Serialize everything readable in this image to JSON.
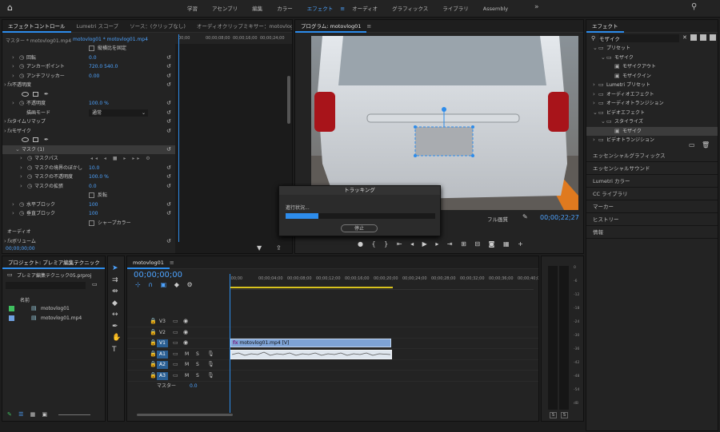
{
  "workspaces": {
    "items": [
      "学習",
      "アセンブリ",
      "編集",
      "カラー",
      "エフェクト",
      "オーディオ",
      "グラフィックス",
      "ライブラリ",
      "Assembly"
    ],
    "active": 4,
    "more": "»"
  },
  "effect_controls": {
    "tabs": [
      "エフェクトコントロール",
      "Lumetri スコープ",
      "ソース：(クリップなし)",
      "オーディオクリップミキサー：motovlog"
    ],
    "source_label": "マスター * motovlog01.mp4",
    "clip_label": "motovlog01 * motovlog01.mp4",
    "ruler": [
      "00;00",
      "00;00;08;00",
      "00;00;16;00",
      "00;00;24;00"
    ],
    "rows": [
      {
        "text": "縦横比を固定",
        "kind": "checkbox",
        "indent": 108,
        "value": ""
      },
      {
        "text": "回転",
        "kind": "prop",
        "indent": 30,
        "value": "0.0"
      },
      {
        "text": "アンカーポイント",
        "kind": "prop",
        "indent": 30,
        "value": "720.0    540.0"
      },
      {
        "text": "アンチフリッカー",
        "kind": "prop",
        "indent": 30,
        "value": "0.00"
      },
      {
        "text": "不透明度",
        "kind": "fx",
        "indent": 12,
        "value": ""
      },
      {
        "text": "",
        "kind": "shapes",
        "indent": 24,
        "value": ""
      },
      {
        "text": "不透明度",
        "kind": "prop",
        "indent": 30,
        "value": "100.0 %"
      },
      {
        "text": "描画モード",
        "kind": "select",
        "indent": 30,
        "value": "通常"
      },
      {
        "text": "タイムリマップ",
        "kind": "fx",
        "indent": 12,
        "value": ""
      },
      {
        "text": "モザイク",
        "kind": "fx",
        "indent": 12,
        "value": ""
      },
      {
        "text": "",
        "kind": "shapes",
        "indent": 24,
        "value": ""
      },
      {
        "text": "マスク (1)",
        "kind": "mask",
        "indent": 24,
        "value": ""
      },
      {
        "text": "マスクパス",
        "kind": "path",
        "indent": 40,
        "value": ""
      },
      {
        "text": "マスクの境界のぼかし",
        "kind": "prop",
        "indent": 40,
        "value": "10.0"
      },
      {
        "text": "マスクの不透明度",
        "kind": "prop",
        "indent": 40,
        "value": "100.0 %"
      },
      {
        "text": "マスクの拡張",
        "kind": "prop",
        "indent": 40,
        "value": "0.0"
      },
      {
        "text": "反転",
        "kind": "checkbox",
        "indent": 108,
        "value": ""
      },
      {
        "text": "水平ブロック",
        "kind": "prop",
        "indent": 30,
        "value": "100"
      },
      {
        "text": "垂直ブロック",
        "kind": "prop",
        "indent": 30,
        "value": "100"
      },
      {
        "text": "シャープカラー",
        "kind": "checkbox",
        "indent": 108,
        "value": ""
      },
      {
        "text": "オーディオ",
        "kind": "section",
        "indent": 6,
        "value": ""
      },
      {
        "text": "ボリューム",
        "kind": "fx",
        "indent": 12,
        "value": ""
      }
    ],
    "timecode": "00;00;00;00"
  },
  "program": {
    "tab": "プログラム: motovlog01",
    "timecode": "00;00;22;27",
    "quality": "フル画質"
  },
  "tracking": {
    "title": "トラッキング",
    "status": "進行状況...",
    "progress": 0.22,
    "stop": "停止"
  },
  "effects": {
    "tab": "エフェクト",
    "search": "モザイク",
    "tree": [
      {
        "label": "プリセット",
        "level": 0,
        "folder": true,
        "open": true
      },
      {
        "label": "モザイク",
        "level": 1,
        "folder": true,
        "open": true
      },
      {
        "label": "モザイクアウト",
        "level": 2,
        "folder": false
      },
      {
        "label": "モザイクイン",
        "level": 2,
        "folder": false
      },
      {
        "label": "Lumetri プリセット",
        "level": 0,
        "folder": true,
        "open": false
      },
      {
        "label": "オーディオエフェクト",
        "level": 0,
        "folder": true,
        "open": false
      },
      {
        "label": "オーディオトランジション",
        "level": 0,
        "folder": true,
        "open": false
      },
      {
        "label": "ビデオエフェクト",
        "level": 0,
        "folder": true,
        "open": true
      },
      {
        "label": "スタイライズ",
        "level": 1,
        "folder": true,
        "open": true
      },
      {
        "label": "モザイク",
        "level": 2,
        "folder": false,
        "selected": true
      },
      {
        "label": "ビデオトランジション",
        "level": 0,
        "folder": true,
        "open": false
      }
    ],
    "panels": [
      "エッセンシャルグラフィックス",
      "エッセンシャルサウンド",
      "Lumetri カラー",
      "CC ライブラリ",
      "マーカー",
      "ヒストリー",
      "情報"
    ]
  },
  "project": {
    "tab": "プロジェクト: プレミア編集テクニック",
    "file": "プレミア編集テクニック05.prproj",
    "col": "名前",
    "items": [
      {
        "name": "motovlog01",
        "color": "#3fbf5f"
      },
      {
        "name": "motovlog01.mp4",
        "color": "#6fa0e0"
      }
    ]
  },
  "timeline": {
    "tab": "motovlog01",
    "timecode": "00;00;00;00",
    "ruler": [
      ":00;00",
      "00;00;04;00",
      "00;00;08;00",
      "00;00;12;00",
      "00;00;16;00",
      "00;00;20;00",
      "00;00;24;00",
      "00;00;28;00",
      "00;00;32;00",
      "00;00;36;00",
      "00;00;40;00"
    ],
    "video_tracks": [
      "V3",
      "V2",
      "V1"
    ],
    "audio_tracks": [
      "A1",
      "A2",
      "A3"
    ],
    "master": "マスター",
    "master_value": "0.0",
    "clip": "motovlog01.mp4 [V]",
    "fx": "fx"
  },
  "meter": {
    "scale": [
      "0",
      "-6",
      "-12",
      "-18",
      "-24",
      "-30",
      "-36",
      "-42",
      "-48",
      "-54",
      "dB"
    ],
    "solo": "S"
  }
}
